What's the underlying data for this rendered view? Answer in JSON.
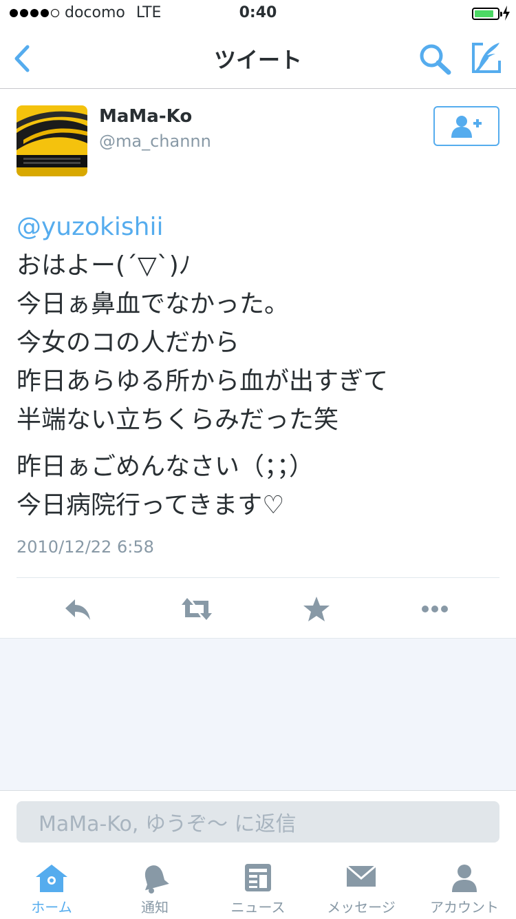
{
  "status_bar": {
    "carrier": "docomo",
    "network": "LTE",
    "time": "0:40",
    "signal_bars": 4,
    "battery_level": 0.85
  },
  "nav": {
    "title": "ツイート"
  },
  "tweet": {
    "display_name": "MaMa-Ko",
    "handle": "@ma_channn",
    "mention": "@yuzokishii",
    "lines": [
      "おはよー(´▽`)ﾉ",
      "今日ぁ鼻血でなかった。",
      "今女のコの人だから",
      "昨日あらゆる所から血が出すぎて",
      "半端ない立ちくらみだった笑"
    ],
    "lines2": [
      "昨日ぁごめんなさい（；；）",
      "今日病院行ってきます♡"
    ],
    "timestamp": "2010/12/22 6:58"
  },
  "reply": {
    "placeholder": "MaMa-Ko, ゆうぞ〜 に返信"
  },
  "tabs": [
    {
      "label": "ホーム",
      "icon": "home-icon",
      "active": true
    },
    {
      "label": "通知",
      "icon": "bell-icon",
      "active": false
    },
    {
      "label": "ニュース",
      "icon": "news-icon",
      "active": false
    },
    {
      "label": "メッセージ",
      "icon": "envelope-icon",
      "active": false
    },
    {
      "label": "アカウント",
      "icon": "person-icon",
      "active": false
    }
  ],
  "colors": {
    "accent": "#55acee",
    "gray": "#8899a6",
    "text": "#292f33",
    "feed_background": "#f2f5fb",
    "battery": "#4cd964"
  }
}
